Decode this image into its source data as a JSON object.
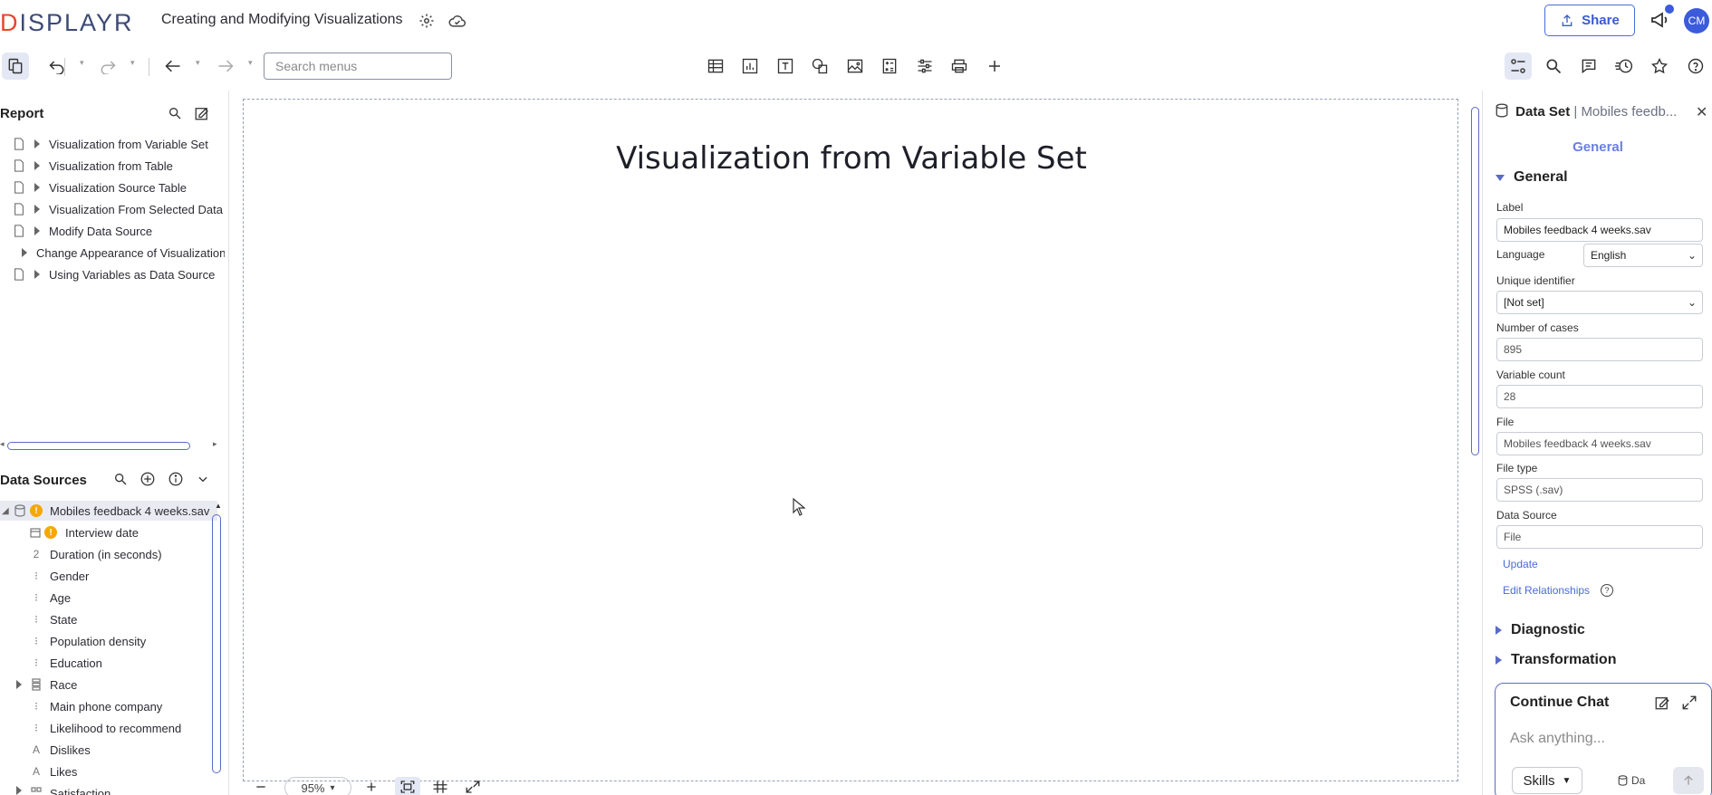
{
  "header": {
    "logo": "DISPLAYR",
    "doc_title": "Creating and Modifying Visualizations",
    "share_label": "Share",
    "avatar_initials": "CM"
  },
  "toolbar": {
    "search_placeholder": "Search menus"
  },
  "report": {
    "title": "Report",
    "items": [
      {
        "label": "Visualization from Variable Set"
      },
      {
        "label": "Visualization from Table"
      },
      {
        "label": "Visualization Source Table"
      },
      {
        "label": "Visualization From Selected Data"
      },
      {
        "label": "Modify Data Source"
      },
      {
        "label": "Change Appearance of Visualization"
      },
      {
        "label": "Using Variables as Data Source"
      }
    ]
  },
  "data_sources": {
    "title": "Data Sources",
    "file_name": "Mobiles feedback 4 weeks.sav",
    "variables": [
      {
        "label": "Interview date",
        "type": "date"
      },
      {
        "label": "Duration (in seconds)",
        "type": "numeric"
      },
      {
        "label": "Gender",
        "type": "nominal"
      },
      {
        "label": "Age",
        "type": "nominal"
      },
      {
        "label": "State",
        "type": "nominal"
      },
      {
        "label": "Population density",
        "type": "nominal"
      },
      {
        "label": "Education",
        "type": "nominal"
      },
      {
        "label": "Race",
        "type": "multi"
      },
      {
        "label": "Main phone company",
        "type": "nominal"
      },
      {
        "label": "Likelihood to recommend",
        "type": "nominal"
      },
      {
        "label": "Dislikes",
        "type": "text"
      },
      {
        "label": "Likes",
        "type": "text"
      },
      {
        "label": "Satisfaction",
        "type": "grid"
      }
    ]
  },
  "canvas": {
    "page_title": "Visualization from Variable Set",
    "zoom": "95%"
  },
  "properties": {
    "header_strong": "Data Set",
    "header_muted": "| Mobiles feedb...",
    "tab": "General",
    "section_general": "General",
    "label_label": "Label",
    "label_value": "Mobiles feedback 4 weeks.sav",
    "language_label": "Language",
    "language_value": "English",
    "unique_id_label": "Unique identifier",
    "unique_id_value": "[Not set]",
    "cases_label": "Number of cases",
    "cases_value": "895",
    "var_count_label": "Variable count",
    "var_count_value": "28",
    "file_label": "File",
    "file_value": "Mobiles feedback 4 weeks.sav",
    "file_type_label": "File type",
    "file_type_value": "SPSS (.sav)",
    "data_source_label": "Data Source",
    "data_source_value": "File",
    "update_link": "Update",
    "edit_rel_link": "Edit Relationships",
    "section_diagnostic": "Diagnostic",
    "section_transformation": "Transformation"
  },
  "chat": {
    "title": "Continue Chat",
    "placeholder": "Ask anything...",
    "skills_label": "Skills",
    "chip_label": "Da"
  },
  "colors": {
    "accent": "#3b5bdb",
    "warning": "#f5a800",
    "logo_red": "#e8452c"
  }
}
